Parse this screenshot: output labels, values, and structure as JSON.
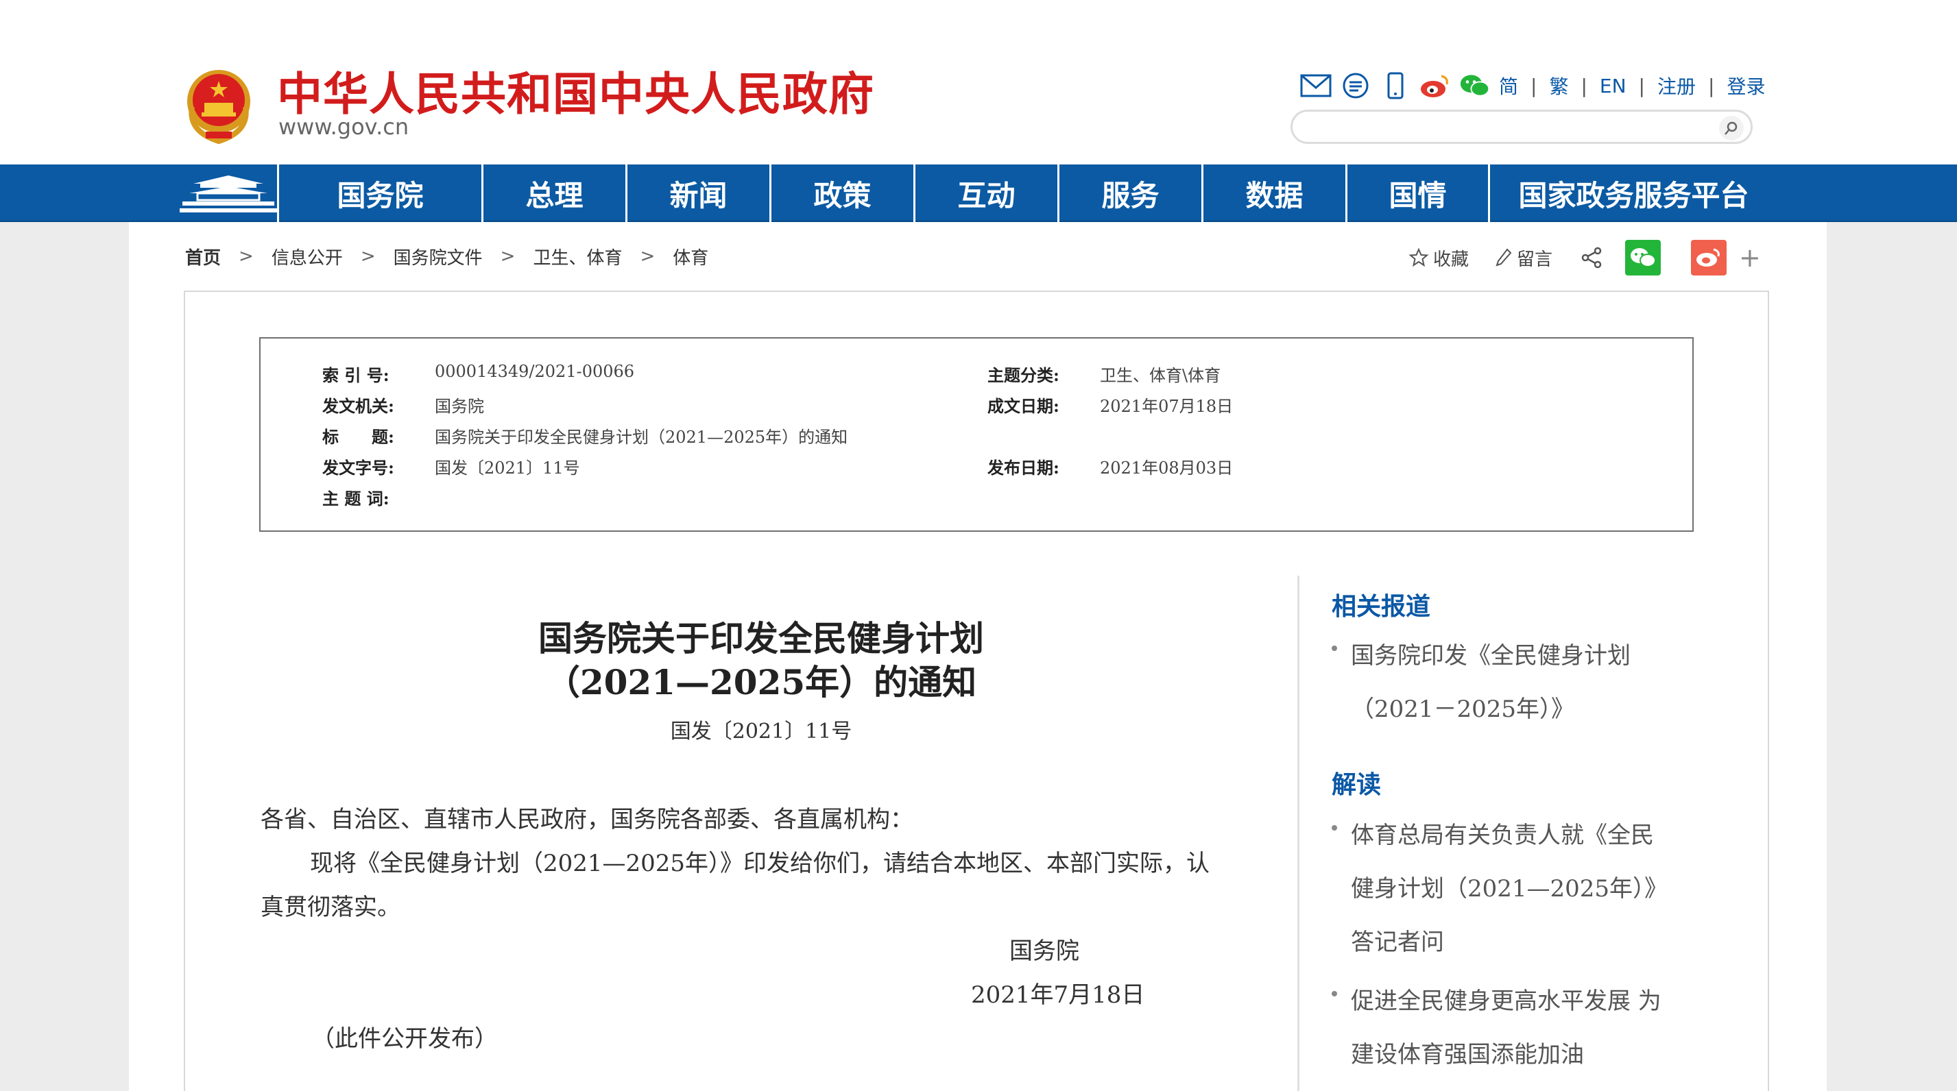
{
  "header": {
    "site_title": "中华人民共和国中央人民政府",
    "site_domain": "www.gov.cn",
    "languages": [
      "简",
      "繁",
      "EN",
      "注册",
      "登录"
    ],
    "search_placeholder": "",
    "icons": [
      "mail-icon",
      "message-icon",
      "mobile-icon",
      "weibo-icon",
      "wechat-icon"
    ]
  },
  "nav": {
    "items": [
      "国务院",
      "总理",
      "新闻",
      "政策",
      "互动",
      "服务",
      "数据",
      "国情",
      "国家政务服务平台"
    ]
  },
  "breadcrumb": [
    "首页",
    "信息公开",
    "国务院文件",
    "卫生、体育",
    "体育"
  ],
  "share": {
    "favorite_label": "收藏",
    "comment_label": "留言"
  },
  "meta": {
    "index_label": "索 引 号:",
    "index_value": "000014349/2021-00066",
    "topic_label": "主题分类:",
    "topic_value": "卫生、体育\\体育",
    "issuer_label": "发文机关:",
    "issuer_value": "国务院",
    "written_label": "成文日期:",
    "written_value": "2021年07月18日",
    "title_label": "标　　题:",
    "title_value": "国务院关于印发全民健身计划（2021—2025年）的通知",
    "docno_label": "发文字号:",
    "docno_value": "国发〔2021〕11号",
    "published_label": "发布日期:",
    "published_value": "2021年08月03日",
    "keywords_label": "主 题 词:"
  },
  "article": {
    "title_line1": "国务院关于印发全民健身计划",
    "title_line2": "（2021—2025年）的通知",
    "doc_number": "国发〔2021〕11号",
    "salutation": "各省、自治区、直辖市人民政府，国务院各部委、各直属机构：",
    "para1_line1": "现将《全民健身计划（2021—2025年）》印发给你们，请结合本地区、本部门实际，认",
    "para1_line2": "真贯彻落实。",
    "signer": "国务院",
    "sign_date": "2021年7月18日",
    "publish_note": "（此件公开发布）"
  },
  "sidebar": {
    "related_heading": "相关报道",
    "related_links": [
      {
        "line1": "国务院印发《全民健身计划",
        "line2": "（2021－2025年）》"
      }
    ],
    "interpret_heading": "解读",
    "interpret_links": [
      {
        "line1": "体育总局有关负责人就《全民",
        "line2": "健身计划（2021—2025年）》",
        "line3": "答记者问"
      },
      {
        "line1": "促进全民健身更高水平发展 为",
        "line2": "建设体育强国添能加油"
      }
    ]
  },
  "colors": {
    "brand_red": "#d21c1c",
    "nav_blue": "#0b5aa3",
    "link_blue": "#0b58a6",
    "wechat_green": "#23b53a",
    "weibo_orange": "#f0604c"
  }
}
